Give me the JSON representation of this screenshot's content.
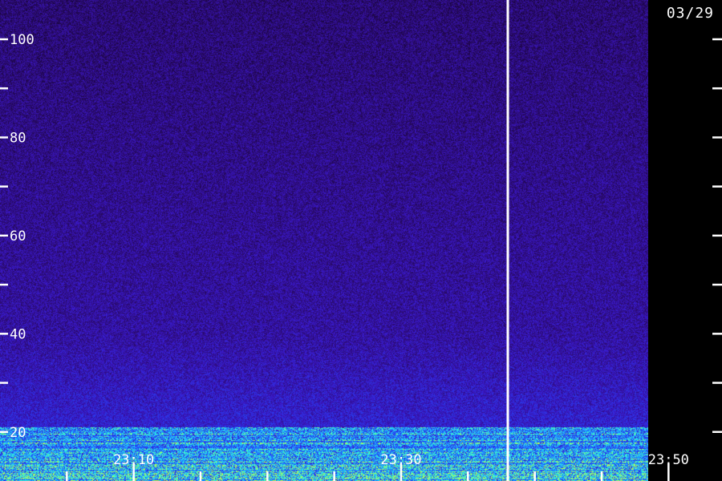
{
  "chart_data": {
    "type": "heatmap",
    "date_label": "03/29",
    "y_axis": {
      "labeled_ticks": [
        100,
        80,
        60,
        40,
        20
      ],
      "minor_ticks": [
        90,
        70,
        50,
        30
      ],
      "ylim": [
        10,
        108
      ]
    },
    "x_axis": {
      "labeled_ticks": [
        {
          "label": "23:10",
          "minute": 10
        },
        {
          "label": "23:30",
          "minute": 30
        },
        {
          "label": "23:50",
          "minute": 50
        }
      ],
      "minor_tick_minutes": [
        5,
        15,
        20,
        25,
        35,
        40,
        45,
        55
      ],
      "xlim_minutes": [
        0,
        54
      ]
    },
    "marker_minute": 38,
    "noise_floor_boundary": 21,
    "colormap": [
      "#0a0018",
      "#2a0a6a",
      "#3a18c8",
      "#2050ff",
      "#20c8ff",
      "#40ffc0",
      "#c8ff40"
    ]
  }
}
